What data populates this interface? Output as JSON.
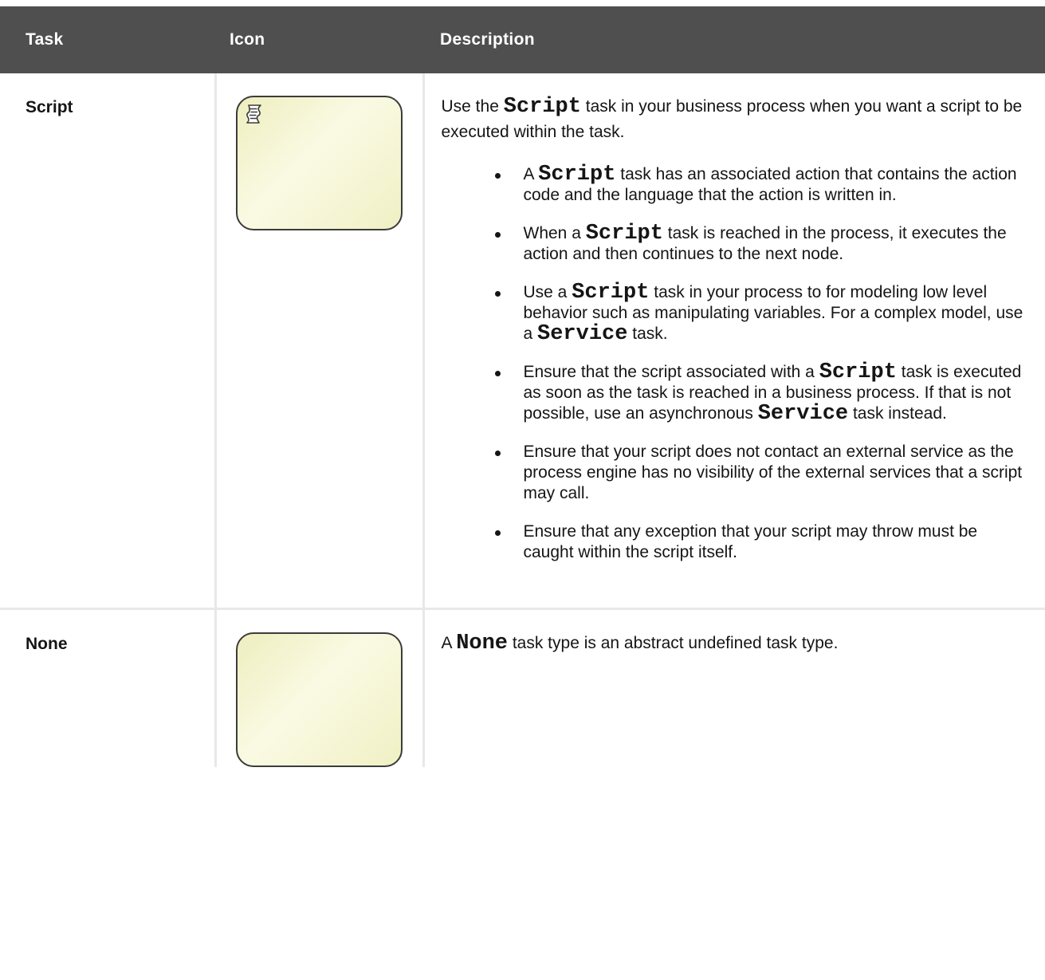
{
  "table": {
    "headers": {
      "task": "Task",
      "icon": "Icon",
      "description": "Description"
    },
    "rows": [
      {
        "task": "Script",
        "icon": "script-task-icon",
        "description": {
          "intro": [
            "Use the ",
            "Script",
            " task in your business process when you want a script to be executed within the task."
          ],
          "bullets": [
            [
              "A ",
              "Script",
              " task has an associated action that contains the action code and the language that the action is written in."
            ],
            [
              "When a ",
              "Script",
              " task is reached in the process, it executes the action and then continues to the next node."
            ],
            [
              "Use a ",
              "Script",
              " task in your process to for modeling low level behavior such as manipulating variables. For a complex model, use a ",
              "Service",
              " task."
            ],
            [
              "Ensure that the script associated with a ",
              "Script",
              " task is executed as soon as the task is reached in a business process. If that is not possible, use an asynchronous ",
              "Service",
              " task instead."
            ],
            [
              "Ensure that your script does not contact an external service as the process engine has no visibility of the external services that a script may call."
            ],
            [
              "Ensure that any exception that your script may throw must be caught within the script itself."
            ]
          ]
        }
      },
      {
        "task": "None",
        "icon": "none-task-icon",
        "description": {
          "intro": [
            "A ",
            "None",
            " task type is an abstract undefined task type."
          ]
        }
      }
    ]
  },
  "colors": {
    "header_bg": "#4f4f4f",
    "header_text": "#ffffff",
    "grid": "#e8e8e8",
    "task_fill": "#f7f7d6",
    "task_border": "#3c3c3c"
  }
}
